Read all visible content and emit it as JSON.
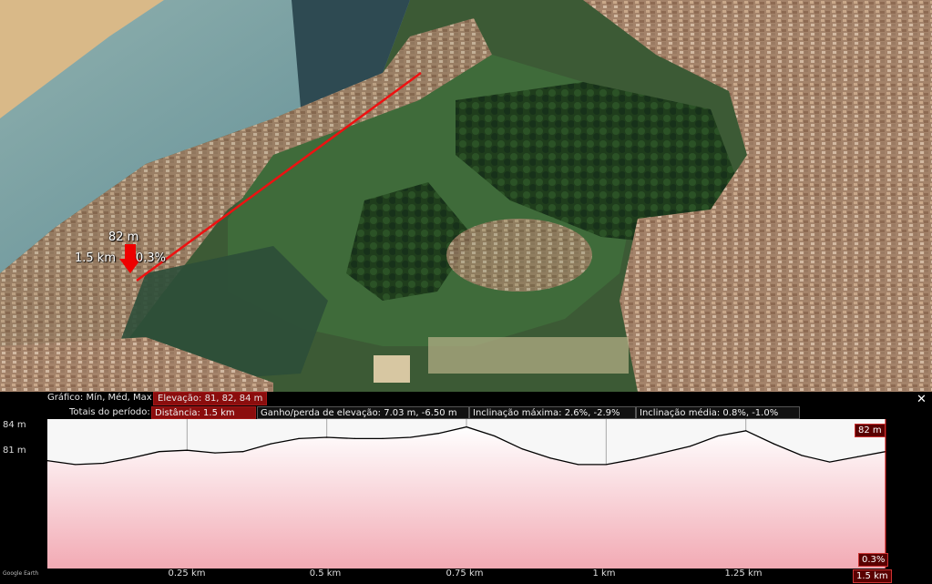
{
  "map": {
    "marker": {
      "elevation": "82 m",
      "distance": "1.5 km",
      "slope": "0.3%"
    }
  },
  "panel": {
    "graph_label": "Gráfico: Mín, Méd, Max",
    "elevation_summary": "Elevação: 81, 82, 84 m",
    "totals_label": "Totais do período:",
    "distance": "Distância: 1.5 km",
    "gain_loss": "Ganho/perda de elevação: 7.03 m, -6.50 m",
    "max_slope": "Inclinação máxima: 2.6%, -2.9%",
    "avg_slope": "Inclinação média: 0.8%, -1.0%",
    "close_icon": "✕",
    "logo": "Google Earth"
  },
  "chart_data": {
    "type": "area",
    "title": "",
    "xlabel": "",
    "ylabel": "",
    "x": [
      0,
      0.05,
      0.1,
      0.15,
      0.2,
      0.25,
      0.3,
      0.35,
      0.4,
      0.45,
      0.5,
      0.55,
      0.6,
      0.65,
      0.7,
      0.75,
      0.8,
      0.85,
      0.9,
      0.95,
      1.0,
      1.05,
      1.1,
      1.15,
      1.2,
      1.25,
      1.3,
      1.35,
      1.4,
      1.45,
      1.5
    ],
    "y": [
      81.3,
      81.0,
      81.1,
      81.5,
      82.0,
      82.1,
      81.9,
      82.0,
      82.6,
      83.0,
      83.1,
      83.0,
      83.0,
      83.1,
      83.4,
      83.9,
      83.2,
      82.2,
      81.5,
      81.0,
      81.0,
      81.4,
      81.9,
      82.4,
      83.2,
      83.6,
      82.6,
      81.7,
      81.2,
      81.6,
      82.0
    ],
    "xlim": [
      0,
      1.5
    ],
    "ylim": [
      73.0,
      84.5
    ],
    "y_ticks": [
      "84 m",
      "81 m"
    ],
    "x_ticks": [
      "0.25 km",
      "0.5 km",
      "0.75 km",
      "1 km",
      "1.25 km"
    ],
    "end_labels": {
      "elevation": "82 m",
      "slope": "0.3%",
      "distance": "1.5 km"
    },
    "fill_color": "#f6c9cf",
    "line_color": "#000000",
    "grid": true
  }
}
